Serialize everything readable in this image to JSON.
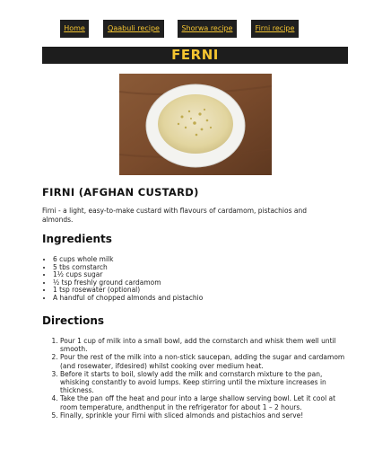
{
  "nav": {
    "items": [
      {
        "label": "Home"
      },
      {
        "label": "Qaabuli recipe"
      },
      {
        "label": "Shorwa recipe"
      },
      {
        "label": "Firni recipe"
      }
    ]
  },
  "banner": {
    "title": "FERNI"
  },
  "colors": {
    "bar_bg": "#1d1d1d",
    "accent": "#f4c430"
  },
  "photo": {
    "alt": "Bowl of firni topped with ground pistachio and cardamom"
  },
  "recipe": {
    "title": "FIRNI (AFGHAN CUSTARD)",
    "intro": "Firni - a light, easy-to-make custard with flavours of cardamom, pistachios and almonds.",
    "ingredients_heading": "Ingredients",
    "ingredients": [
      "6 cups whole milk",
      "5 tbs cornstarch",
      "1½ cups sugar",
      "½ tsp freshly ground cardamom",
      "1 tsp rosewater (optional)",
      "A handful of chopped almonds and pistachio"
    ],
    "directions_heading": "Directions",
    "directions": [
      "Pour 1 cup of milk into a small bowl, add the cornstarch and whisk them well until smooth.",
      "Pour the rest of the milk into a non-stick saucepan, adding the sugar and cardamom (and rosewater, ifdesired) whilst cooking over medium heat.",
      "Before it starts to boil, slowly add the milk and cornstarch mixture to the pan, whisking constantly to avoid lumps. Keep stirring until the mixture increases in thickness.",
      "Take the pan off the heat and pour into a large shallow serving bowl. Let it cool at room temperature, andthenput in the refrigerator for about 1 – 2 hours.",
      "Finally, sprinkle your Firni with sliced almonds and pistachios and serve!"
    ]
  }
}
